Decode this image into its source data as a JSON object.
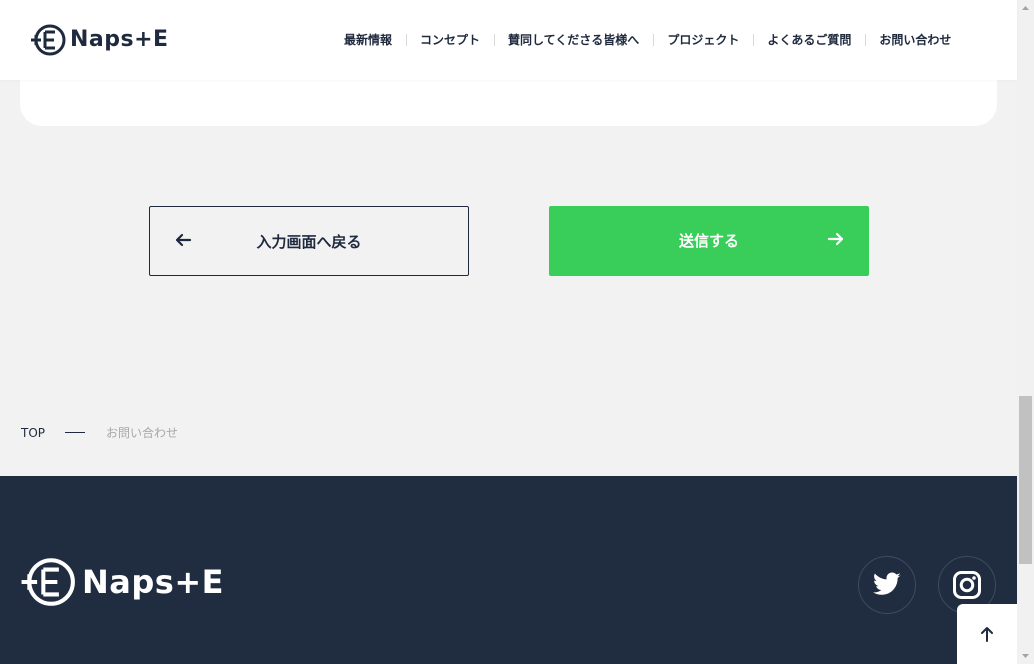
{
  "header": {
    "logo_text": "Naps+E",
    "nav": [
      {
        "label": "最新情報"
      },
      {
        "label": "コンセプト"
      },
      {
        "label": "賛同してくださる皆様へ"
      },
      {
        "label": "プロジェクト"
      },
      {
        "label": "よくあるご質問"
      },
      {
        "label": "お問い合わせ"
      }
    ]
  },
  "form": {
    "back_label": "入力画面へ戻る",
    "send_label": "送信する"
  },
  "breadcrumb": {
    "top": "TOP",
    "current": "お問い合わせ"
  },
  "footer": {
    "logo_text": "Naps+E",
    "social": [
      "twitter-icon",
      "instagram-icon"
    ]
  },
  "colors": {
    "accent_green": "#39cd5a",
    "navy": "#1f2a3e",
    "footer_bg": "#202c40",
    "page_bg": "#f3f2f2"
  }
}
